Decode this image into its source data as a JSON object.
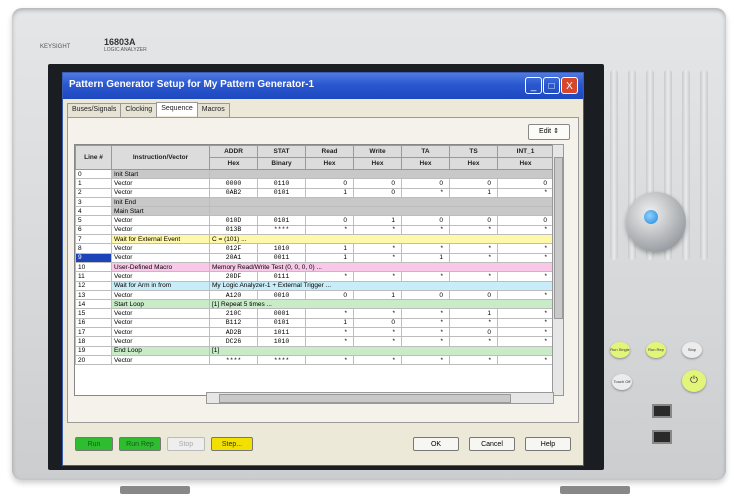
{
  "instrument": {
    "brand": "KEYSIGHT",
    "model": "16803A",
    "model_sub": "LOGIC ANALYZER"
  },
  "window": {
    "title": "Pattern Generator Setup for My Pattern Generator-1",
    "controls": {
      "minimize": "_",
      "maximize": "□",
      "close": "X"
    }
  },
  "tabs": [
    {
      "label": "Buses/Signals",
      "active": false
    },
    {
      "label": "Clocking",
      "active": false
    },
    {
      "label": "Sequence",
      "active": true
    },
    {
      "label": "Macros",
      "active": false
    }
  ],
  "edit_button": "Edit",
  "table": {
    "headers": {
      "line": "Line #",
      "instruction": "Instruction/Vector",
      "cols": [
        {
          "name": "ADDR",
          "format": "Hex"
        },
        {
          "name": "STAT",
          "format": "Binary"
        },
        {
          "name": "Read",
          "format": "Hex"
        },
        {
          "name": "Write",
          "format": "Hex"
        },
        {
          "name": "TA",
          "format": "Hex"
        },
        {
          "name": "TS",
          "format": "Hex"
        },
        {
          "name": "INT_1",
          "format": "Hex"
        }
      ]
    },
    "rows": [
      {
        "line": "0",
        "instr": "Init Start",
        "type": "header",
        "vals": []
      },
      {
        "line": "1",
        "instr": "Vector",
        "type": "vector",
        "vals": [
          "0000",
          "0110",
          "0",
          "0",
          "0",
          "0",
          "0"
        ]
      },
      {
        "line": "2",
        "instr": "Vector",
        "type": "vector",
        "vals": [
          "0AB2",
          "0101",
          "1",
          "0",
          "*",
          "1",
          "*"
        ]
      },
      {
        "line": "3",
        "instr": "Init End",
        "type": "header",
        "vals": []
      },
      {
        "line": "4",
        "instr": "Main Start",
        "type": "header",
        "vals": []
      },
      {
        "line": "5",
        "instr": "Vector",
        "type": "vector",
        "vals": [
          "010D",
          "0101",
          "0",
          "1",
          "0",
          "0",
          "0"
        ]
      },
      {
        "line": "6",
        "instr": "Vector",
        "type": "vector",
        "vals": [
          "013B",
          "****",
          "*",
          "*",
          "*",
          "*",
          "*"
        ]
      },
      {
        "line": "7",
        "instr": "Wait for External Event",
        "type": "wait",
        "text": "C = (101) ..."
      },
      {
        "line": "8",
        "instr": "Vector",
        "type": "vector",
        "vals": [
          "012F",
          "1010",
          "1",
          "*",
          "*",
          "*",
          "*"
        ]
      },
      {
        "line": "9",
        "instr": "Vector",
        "type": "vector",
        "selected": true,
        "vals": [
          "20A1",
          "0011",
          "1",
          "*",
          "1",
          "*",
          "*"
        ]
      },
      {
        "line": "10",
        "instr": "User-Defined Macro",
        "type": "macro",
        "text": "Memory Read/Write Test (0, 0, 0, 0) ..."
      },
      {
        "line": "11",
        "instr": "Vector",
        "type": "vector",
        "vals": [
          "20DF",
          "0111",
          "*",
          "*",
          "*",
          "*",
          "*"
        ]
      },
      {
        "line": "12",
        "instr": "Wait for Arm in from",
        "type": "arm",
        "text": "My Logic Analyzer-1 + External Trigger ..."
      },
      {
        "line": "13",
        "instr": "Vector",
        "type": "vector",
        "vals": [
          "A120",
          "0010",
          "0",
          "1",
          "0",
          "0",
          "*"
        ]
      },
      {
        "line": "14",
        "instr": "Start Loop",
        "type": "loop",
        "text": "[1]  Repeat 5 times ..."
      },
      {
        "line": "15",
        "instr": "Vector",
        "type": "vector",
        "vals": [
          "210C",
          "0001",
          "*",
          "*",
          "*",
          "1",
          "*"
        ]
      },
      {
        "line": "16",
        "instr": "Vector",
        "type": "vector",
        "vals": [
          "B112",
          "0101",
          "1",
          "0",
          "*",
          "*",
          "*"
        ]
      },
      {
        "line": "17",
        "instr": "Vector",
        "type": "vector",
        "vals": [
          "AD2B",
          "1011",
          "*",
          "*",
          "*",
          "0",
          "*"
        ]
      },
      {
        "line": "18",
        "instr": "Vector",
        "type": "vector",
        "vals": [
          "DC26",
          "1010",
          "*",
          "*",
          "*",
          "*",
          "*"
        ]
      },
      {
        "line": "19",
        "instr": "End Loop",
        "type": "loop",
        "text": "[1]"
      },
      {
        "line": "20",
        "instr": "Vector",
        "type": "vector",
        "vals": [
          "****",
          "****",
          "*",
          "*",
          "*",
          "*",
          "*"
        ]
      }
    ]
  },
  "buttons": {
    "run": "Run",
    "run_rep": "Run Rep",
    "stop": "Stop",
    "step": "Step...",
    "ok": "OK",
    "cancel": "Cancel",
    "help": "Help"
  },
  "front_panel": {
    "run_single": "Run Single",
    "run_rep": "Run Rep",
    "stop": "Stop",
    "touch_off": "Touch Off",
    "power": "⏻"
  },
  "colors": {
    "title_blue": "#2a57cf",
    "header_row": "#c8c8c8",
    "wait_row": "#fff8a8",
    "macro_row": "#f9c8e8",
    "arm_row": "#c8ecf8",
    "loop_row": "#c8ecc8",
    "selected": "#1c44b8",
    "run_green": "#2ebd2e",
    "step_yellow": "#f2e000"
  }
}
